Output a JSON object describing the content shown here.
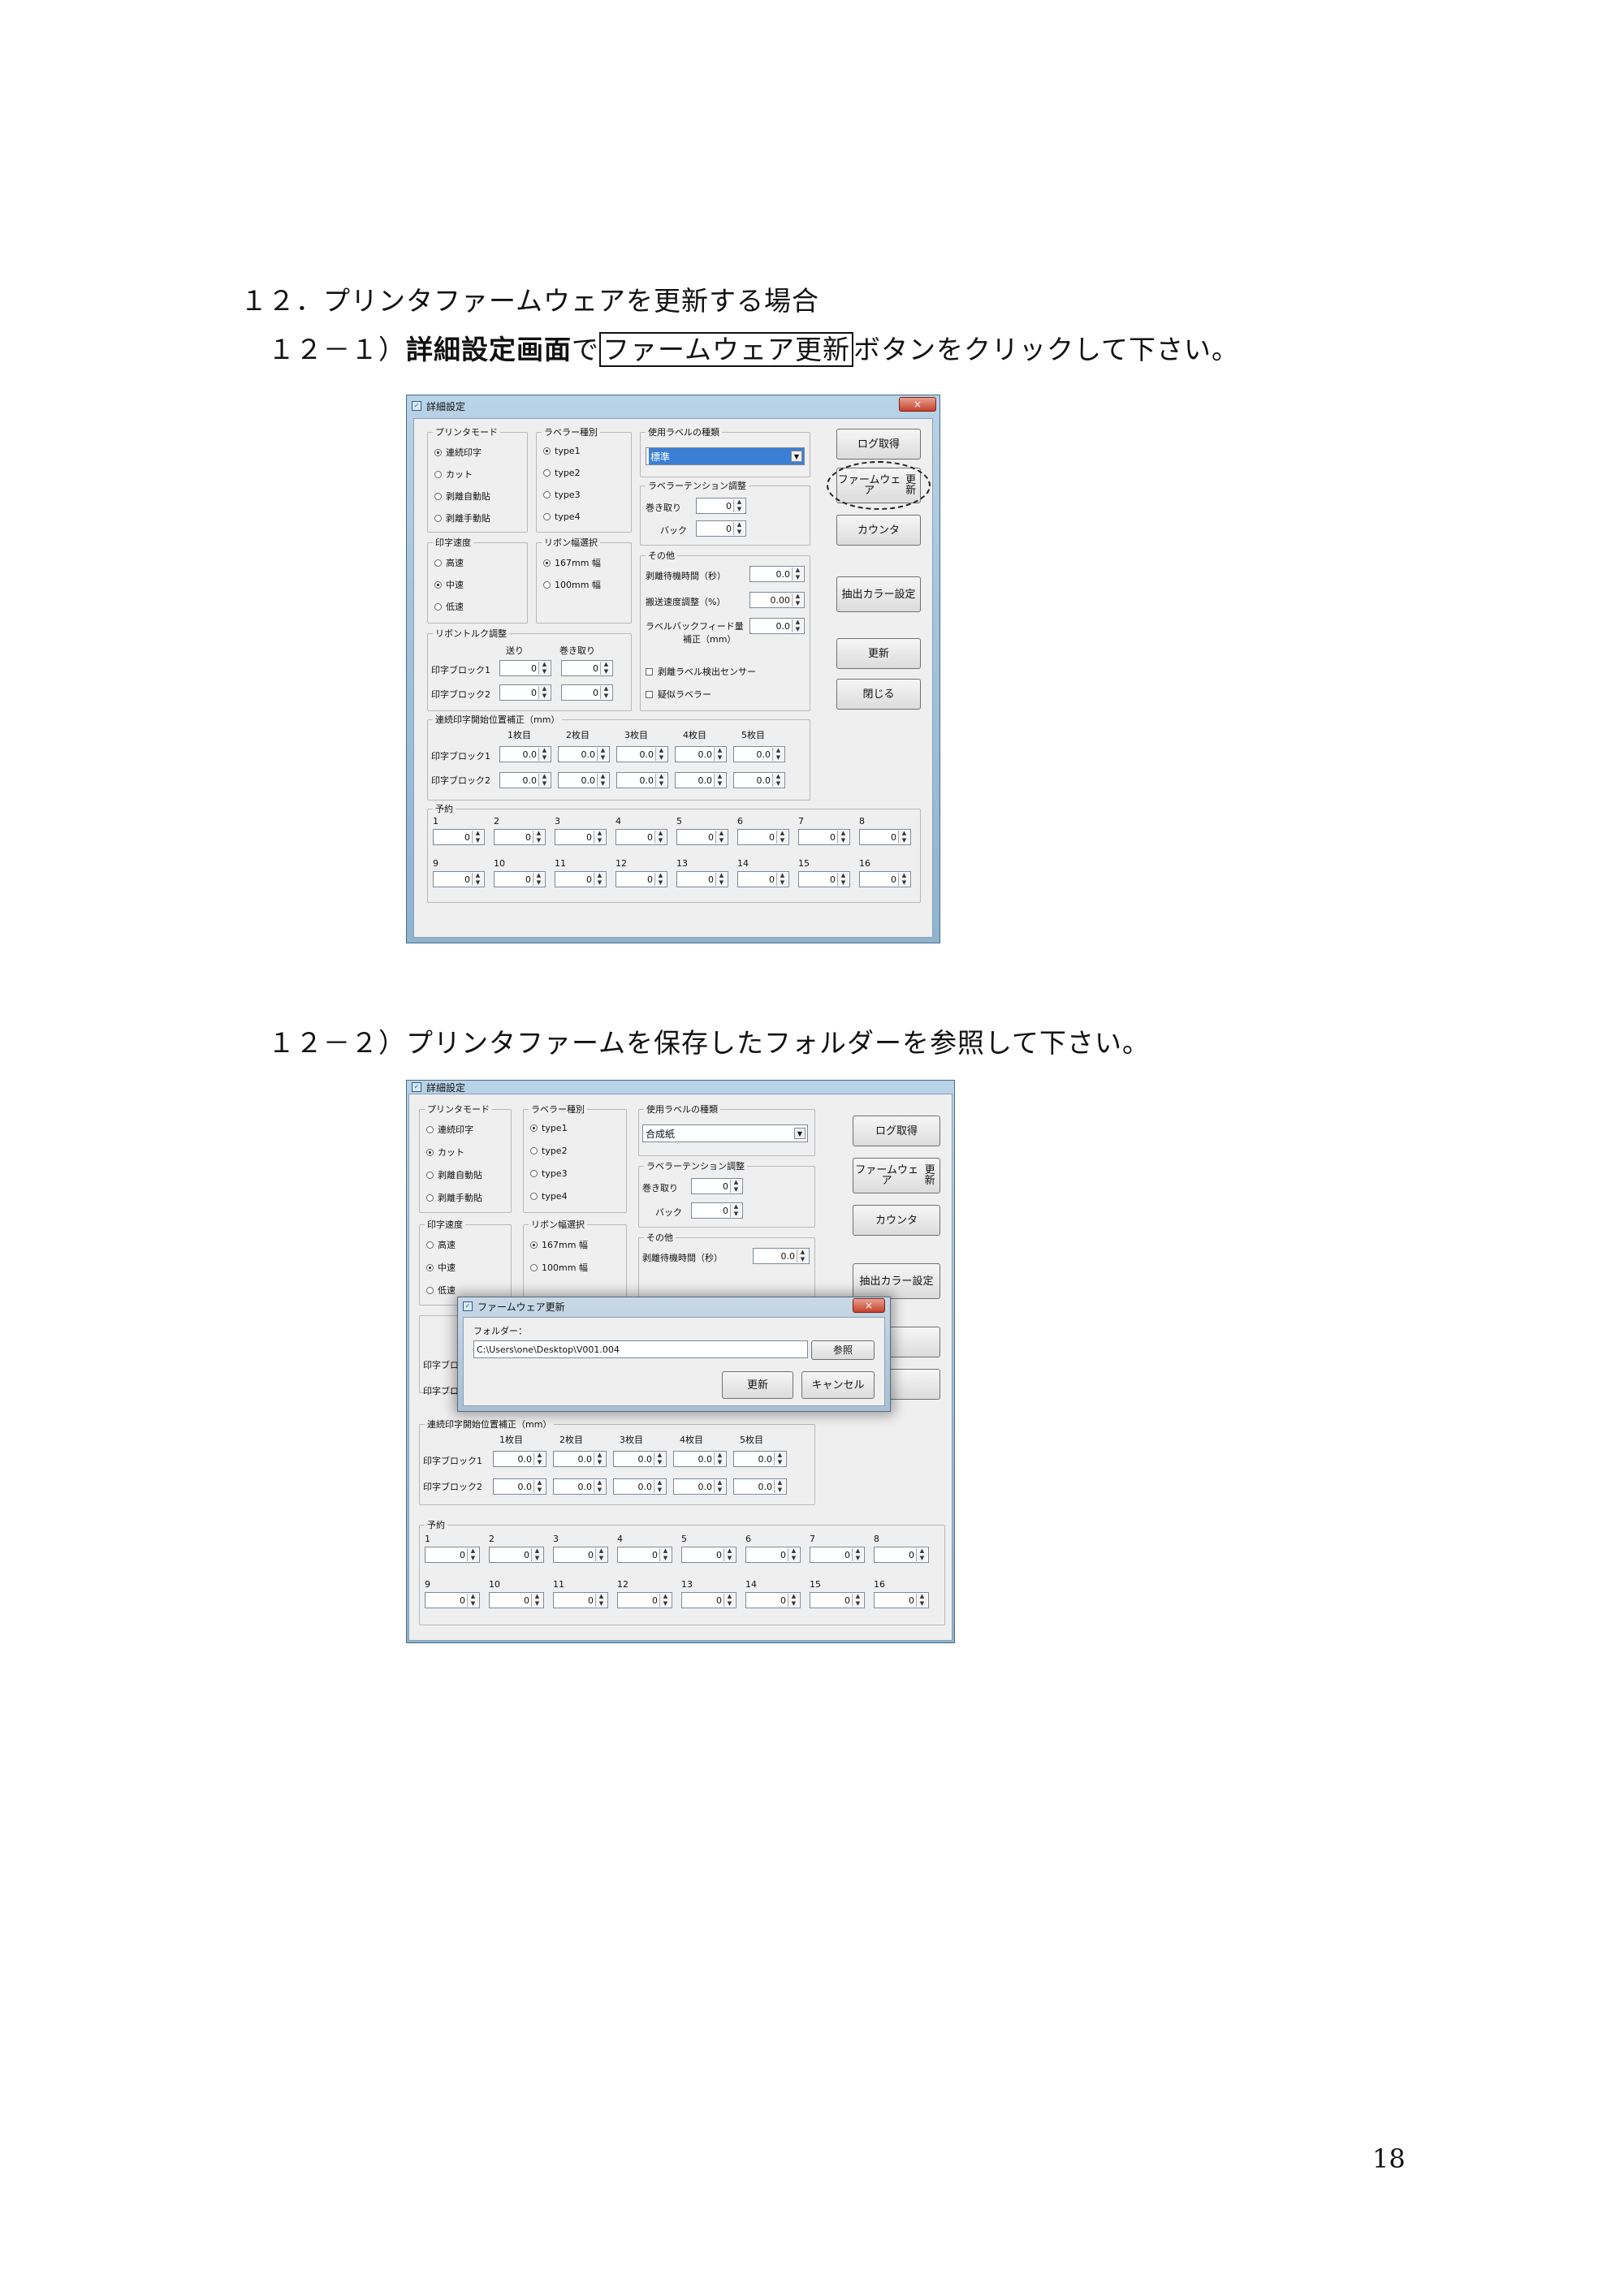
{
  "doc": {
    "heading": "１２．プリンタファームウェアを更新する場合",
    "step1_pre": "１２－１）",
    "step1_bold": "詳細設定画面",
    "step1_mid": "で",
    "step1_boxed": "ファームウェア更新",
    "step1_post": "ボタンをクリックして下さい。",
    "step2": "１２－２）プリンタファームを保存したフォルダーを参照して下さい。",
    "page_number": "18"
  },
  "window": {
    "title": "詳細設定",
    "close": "×",
    "printer_mode": {
      "label": "プリンタモード",
      "options": [
        "連続印字",
        "カット",
        "剥離自動貼",
        "剥離手動貼"
      ]
    },
    "labeler_type": {
      "label": "ラベラー種別",
      "options": [
        "type1",
        "type2",
        "type3",
        "type4"
      ]
    },
    "label_kind": {
      "label": "使用ラベルの種類",
      "value1": "標準",
      "value2": "合成紙"
    },
    "tension": {
      "label": "ラベラーテンション調整",
      "wind_label": "巻き取り",
      "back_label": "バック",
      "wind_value": "0",
      "back_value": "0"
    },
    "print_speed": {
      "label": "印字速度",
      "options": [
        "高速",
        "中速",
        "低速"
      ]
    },
    "ribbon_width": {
      "label": "リボン幅選択",
      "options": [
        "167mm 幅",
        "100mm 幅"
      ]
    },
    "other": {
      "label": "その他",
      "peel_wait_label": "剥離待機時間（秒）",
      "peel_wait_value": "0.0",
      "speed_adj_label": "搬送速度調整（%）",
      "speed_adj_value": "0.00",
      "backfeed_label": "ラベルバックフィード量",
      "backfeed_label2": "補正（mm）",
      "backfeed_value": "0.0",
      "peel_sensor_label": "剥離ラベル検出センサー",
      "pseudo_labeler_label": "疑似ラベラー"
    },
    "ribbon_torque": {
      "label": "リボントルク調整",
      "col_send": "送り",
      "col_wind": "巻き取り",
      "rows": [
        {
          "label": "印字ブロック1",
          "send": "0",
          "wind": "0"
        },
        {
          "label": "印字ブロック2",
          "send": "0",
          "wind": "0"
        }
      ]
    },
    "start_pos": {
      "label": "連続印字開始位置補正（mm）",
      "cols": [
        "1枚目",
        "2枚目",
        "3枚目",
        "4枚目",
        "5枚目"
      ],
      "rows": [
        {
          "label": "印字ブロック1",
          "values": [
            "0.0",
            "0.0",
            "0.0",
            "0.0",
            "0.0"
          ]
        },
        {
          "label": "印字ブロック2",
          "values": [
            "0.0",
            "0.0",
            "0.0",
            "0.0",
            "0.0"
          ]
        }
      ]
    },
    "reserve": {
      "label": "予約",
      "row1_labels": [
        "1",
        "2",
        "3",
        "4",
        "5",
        "6",
        "7",
        "8"
      ],
      "row2_labels": [
        "9",
        "10",
        "11",
        "12",
        "13",
        "14",
        "15",
        "16"
      ],
      "value": "0"
    },
    "buttons": {
      "log": "ログ取得",
      "fw_line1": "ファームウェア",
      "fw_line2": "更新",
      "counter": "カウンタ",
      "color_line1": "抽出カラー",
      "color_line2": "設定",
      "update": "更新",
      "close": "閉じる"
    }
  },
  "fw_dialog": {
    "title": "ファームウェア更新",
    "folder_label": "フォルダー：",
    "folder_path": "C:\\Users\\one\\Desktop\\V001.004",
    "browse": "参照",
    "update": "更新",
    "cancel": "キャンセル",
    "close": "×"
  },
  "colors": {
    "window_frame": "#a4c4dc",
    "client_bg": "#efefef",
    "selection": "#3b7fd4",
    "close_red": "#c6412c"
  }
}
